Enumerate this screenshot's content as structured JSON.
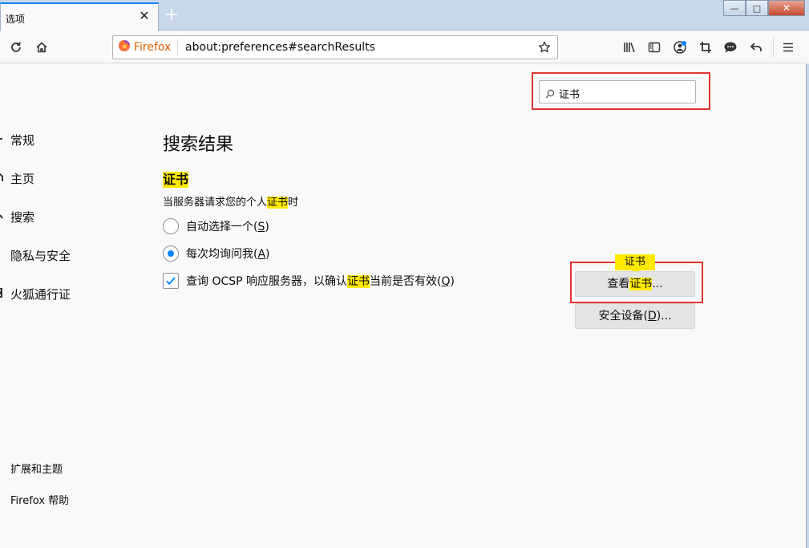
{
  "window": {
    "tab_title": "选项",
    "tab_close": "✕",
    "new_tab": "+",
    "minimize": "—",
    "maximize": "□",
    "close": "✕"
  },
  "navbar": {
    "identity_label": "Firefox",
    "url": "about:preferences#searchResults"
  },
  "search": {
    "value": "证书"
  },
  "sidebar": {
    "items": [
      {
        "icon": "gear-icon",
        "label": "常规"
      },
      {
        "icon": "home-icon",
        "label": "主页"
      },
      {
        "icon": "search-icon",
        "label": "搜索"
      },
      {
        "icon": "lock-icon",
        "label": "隐私与安全"
      },
      {
        "icon": "sync-icon",
        "label": "火狐通行证"
      }
    ],
    "footer": {
      "addons": "扩展和主题",
      "help": "Firefox 帮助"
    }
  },
  "main": {
    "heading": "搜索结果",
    "section_title": "证书",
    "desc_before": "当服务器请求您的个人",
    "desc_highlight": "证书",
    "desc_after": "时",
    "radio_auto": {
      "prefix": "自动选择一个(",
      "key": "S",
      "suffix": ")",
      "selected": false
    },
    "radio_ask": {
      "prefix": "每次均询问我(",
      "key": "A",
      "suffix": ")",
      "selected": true
    },
    "ocsp": {
      "before": "查询 OCSP 响应服务器，以确认",
      "highlight": "证书",
      "after": "当前是否有效(",
      "key": "Q",
      "suffix": ")",
      "checked": true
    },
    "tooltip": "证书",
    "view_btn": {
      "before": "查看",
      "highlight": "证书",
      "after": "..."
    },
    "devices_btn": {
      "prefix": "安全设备(",
      "key": "D",
      "suffix": ")..."
    }
  },
  "colors": {
    "highlight": "#ffe900",
    "annotation_red": "#e0362f",
    "accent_blue": "#0a84ff"
  }
}
